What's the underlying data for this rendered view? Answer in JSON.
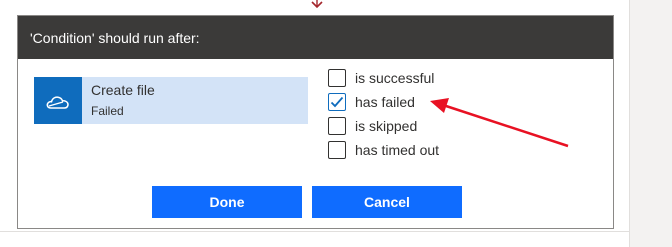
{
  "dialog": {
    "title": "'Condition' should run after:",
    "source": {
      "title": "Create file",
      "status": "Failed",
      "icon": "onedrive-cloud-icon"
    },
    "options": [
      {
        "label": "is successful",
        "checked": false
      },
      {
        "label": "has failed",
        "checked": true
      },
      {
        "label": "is skipped",
        "checked": false
      },
      {
        "label": "has timed out",
        "checked": false
      }
    ],
    "buttons": {
      "done": "Done",
      "cancel": "Cancel"
    }
  },
  "colors": {
    "header_bg": "#3b3a39",
    "accent": "#0f6cff",
    "source_card_bg": "#d3e3f7",
    "annotation_arrow": "#e81123"
  }
}
